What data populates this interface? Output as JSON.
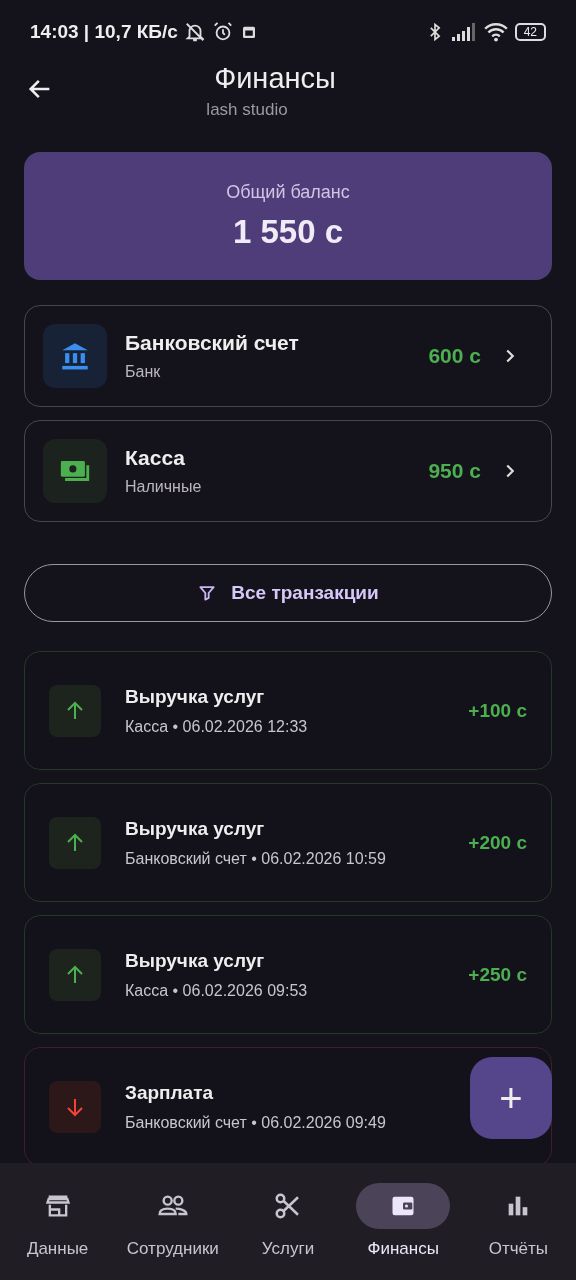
{
  "status_bar": {
    "time": "14:03 | 10,7 КБ/с",
    "battery": "42"
  },
  "header": {
    "title": "Финансы",
    "subtitle": "lash studio"
  },
  "balance": {
    "label": "Общий баланс",
    "amount": "1 550 с"
  },
  "accounts": [
    {
      "kind": "bank",
      "name": "Банковский счет",
      "type": "Банк",
      "amount": "600 с"
    },
    {
      "kind": "cash",
      "name": "Касса",
      "type": "Наличные",
      "amount": "950 с"
    }
  ],
  "filter_button": {
    "label": "Все транзакции"
  },
  "transactions": [
    {
      "kind": "income",
      "title": "Выручка услуг",
      "details": "Касса • 06.02.2026 12:33",
      "amount": "+100 с"
    },
    {
      "kind": "income",
      "title": "Выручка услуг",
      "details": "Банковский счет • 06.02.2026 10:59",
      "amount": "+200 с"
    },
    {
      "kind": "income",
      "title": "Выручка услуг",
      "details": "Касса • 06.02.2026 09:53",
      "amount": "+250 с"
    },
    {
      "kind": "expense",
      "title": "Зарплата",
      "details": "Банковский счет • 06.02.2026 09:49"
    }
  ],
  "fab": {
    "label": "+"
  },
  "bottom_nav": [
    {
      "kind": "store",
      "label": "Данные",
      "selected": false
    },
    {
      "kind": "people",
      "label": "Сотрудники",
      "selected": false
    },
    {
      "kind": "scissors",
      "label": "Услуги",
      "selected": false
    },
    {
      "kind": "wallet",
      "label": "Финансы",
      "selected": true
    },
    {
      "kind": "chart",
      "label": "Отчёты",
      "selected": false
    }
  ]
}
